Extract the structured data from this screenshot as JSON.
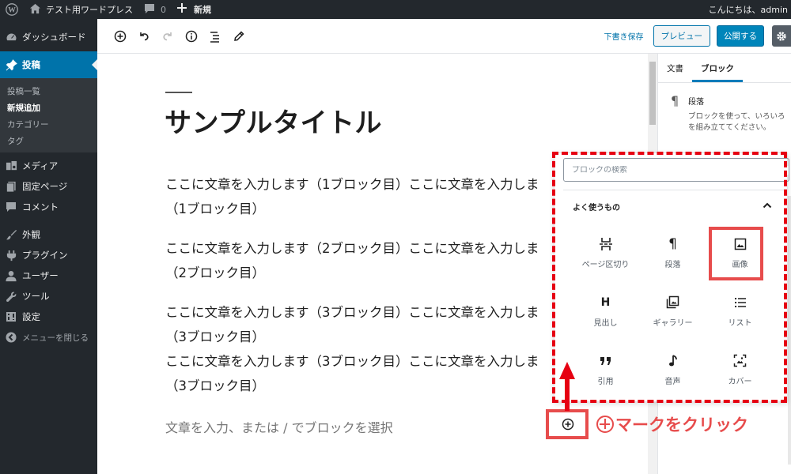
{
  "adminbar": {
    "site_name": "テスト用ワードプレス",
    "comments_count": "0",
    "new_label": "新規",
    "greeting": "こんにちは、admin"
  },
  "sidebar": {
    "dashboard": "ダッシュボード",
    "posts": "投稿",
    "posts_submenu": [
      "投稿一覧",
      "新規追加",
      "カテゴリー",
      "タグ"
    ],
    "media": "メディア",
    "pages": "固定ページ",
    "comments": "コメント",
    "appearance": "外観",
    "plugins": "プラグイン",
    "users": "ユーザー",
    "tools": "ツール",
    "settings": "設定",
    "collapse": "メニューを閉じる"
  },
  "header": {
    "save_draft": "下書き保存",
    "preview": "プレビュー",
    "publish": "公開する"
  },
  "content": {
    "title": "サンプルタイトル",
    "paragraphs": [
      [
        "ここに文章を入力します（1ブロック目）ここに文章を入力しま",
        "（1ブロック目）"
      ],
      [
        "ここに文章を入力します（2ブロック目）ここに文章を入力しま",
        "（2ブロック目）"
      ],
      [
        "ここに文章を入力します（3ブロック目）ここに文章を入力しま",
        "（3ブロック目）"
      ],
      [
        "ここに文章を入力します（3ブロック目）ここに文章を入力しま",
        "（3ブロック目）"
      ]
    ],
    "placeholder": "文章を入力、または / でブロックを選択"
  },
  "right_panel": {
    "tabs": [
      "文書",
      "ブロック"
    ],
    "active_tab": "ブロック",
    "block_name": "段落",
    "block_desc": "ブロックを使って、いろいろ を組み立ててください。"
  },
  "inserter": {
    "search_placeholder": "ブロックの検索",
    "section_title": "よく使うもの",
    "blocks": [
      {
        "label": "ページ区切り",
        "icon": "page-break-icon"
      },
      {
        "label": "段落",
        "icon": "paragraph-icon"
      },
      {
        "label": "画像",
        "icon": "image-icon"
      },
      {
        "label": "見出し",
        "icon": "heading-icon"
      },
      {
        "label": "ギャラリー",
        "icon": "gallery-icon"
      },
      {
        "label": "リスト",
        "icon": "list-icon"
      },
      {
        "label": "引用",
        "icon": "quote-icon"
      },
      {
        "label": "音声",
        "icon": "audio-icon"
      },
      {
        "label": "カバー",
        "icon": "cover-icon"
      }
    ]
  },
  "annotation": {
    "callout": "マークをクリック",
    "color": "#e74c4c",
    "dash_color": "#e60012"
  },
  "colors": {
    "admin_dark": "#23282d",
    "accent_blue": "#0073aa",
    "publish_blue": "#0085ba"
  }
}
